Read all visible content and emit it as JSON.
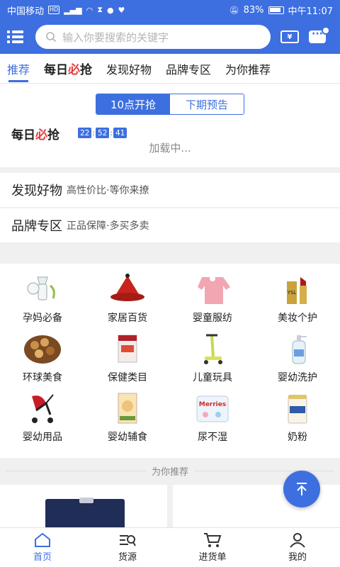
{
  "status_bar": {
    "carrier": "中国移动",
    "battery": "83%",
    "time": "中午11:07"
  },
  "search": {
    "placeholder": "输入你要搜索的关键字"
  },
  "tabs": [
    {
      "label": "推荐"
    },
    {
      "label": "每日",
      "label_red": "必",
      "label_tail": "抢"
    },
    {
      "label": "发现好物"
    },
    {
      "label": "品牌专区"
    },
    {
      "label": "为你推荐"
    }
  ],
  "flash_sale": {
    "seg_now": "10点开抢",
    "seg_next": "下期预告",
    "title_a": "每日",
    "title_red": "必",
    "title_b": "抢",
    "timer": {
      "h": "22",
      "m": "52",
      "s": "41"
    },
    "loading": "加载中..."
  },
  "discover": {
    "title": "发现好物",
    "subtitle": "高性价比·等你来撩"
  },
  "brand": {
    "title": "品牌专区",
    "subtitle": "正品保障·多买多卖"
  },
  "categories": [
    {
      "label": "孕妈必备",
      "icon": "breast-pump-icon"
    },
    {
      "label": "家居百货",
      "icon": "tagine-pot-icon"
    },
    {
      "label": "婴童服纺",
      "icon": "baby-bib-icon"
    },
    {
      "label": "美妆个护",
      "icon": "lipstick-icon"
    },
    {
      "label": "环球美食",
      "icon": "nuts-bowl-icon"
    },
    {
      "label": "保健类目",
      "icon": "supplement-box-icon"
    },
    {
      "label": "儿童玩具",
      "icon": "scooter-icon"
    },
    {
      "label": "婴幼洗护",
      "icon": "lotion-bottle-icon"
    },
    {
      "label": "婴幼用品",
      "icon": "stroller-icon"
    },
    {
      "label": "婴幼辅食",
      "icon": "cereal-box-icon"
    },
    {
      "label": "尿不湿",
      "icon": "diaper-pack-icon"
    },
    {
      "label": "奶粉",
      "icon": "formula-can-icon"
    }
  ],
  "recommend_header": "为你推荐",
  "bottom_nav": [
    {
      "label": "首页",
      "icon": "home-icon"
    },
    {
      "label": "货源",
      "icon": "source-search-icon"
    },
    {
      "label": "进货单",
      "icon": "cart-icon"
    },
    {
      "label": "我的",
      "icon": "profile-icon"
    }
  ],
  "colors": {
    "primary": "#3d6fe0",
    "accent_red": "#e43a3a"
  }
}
